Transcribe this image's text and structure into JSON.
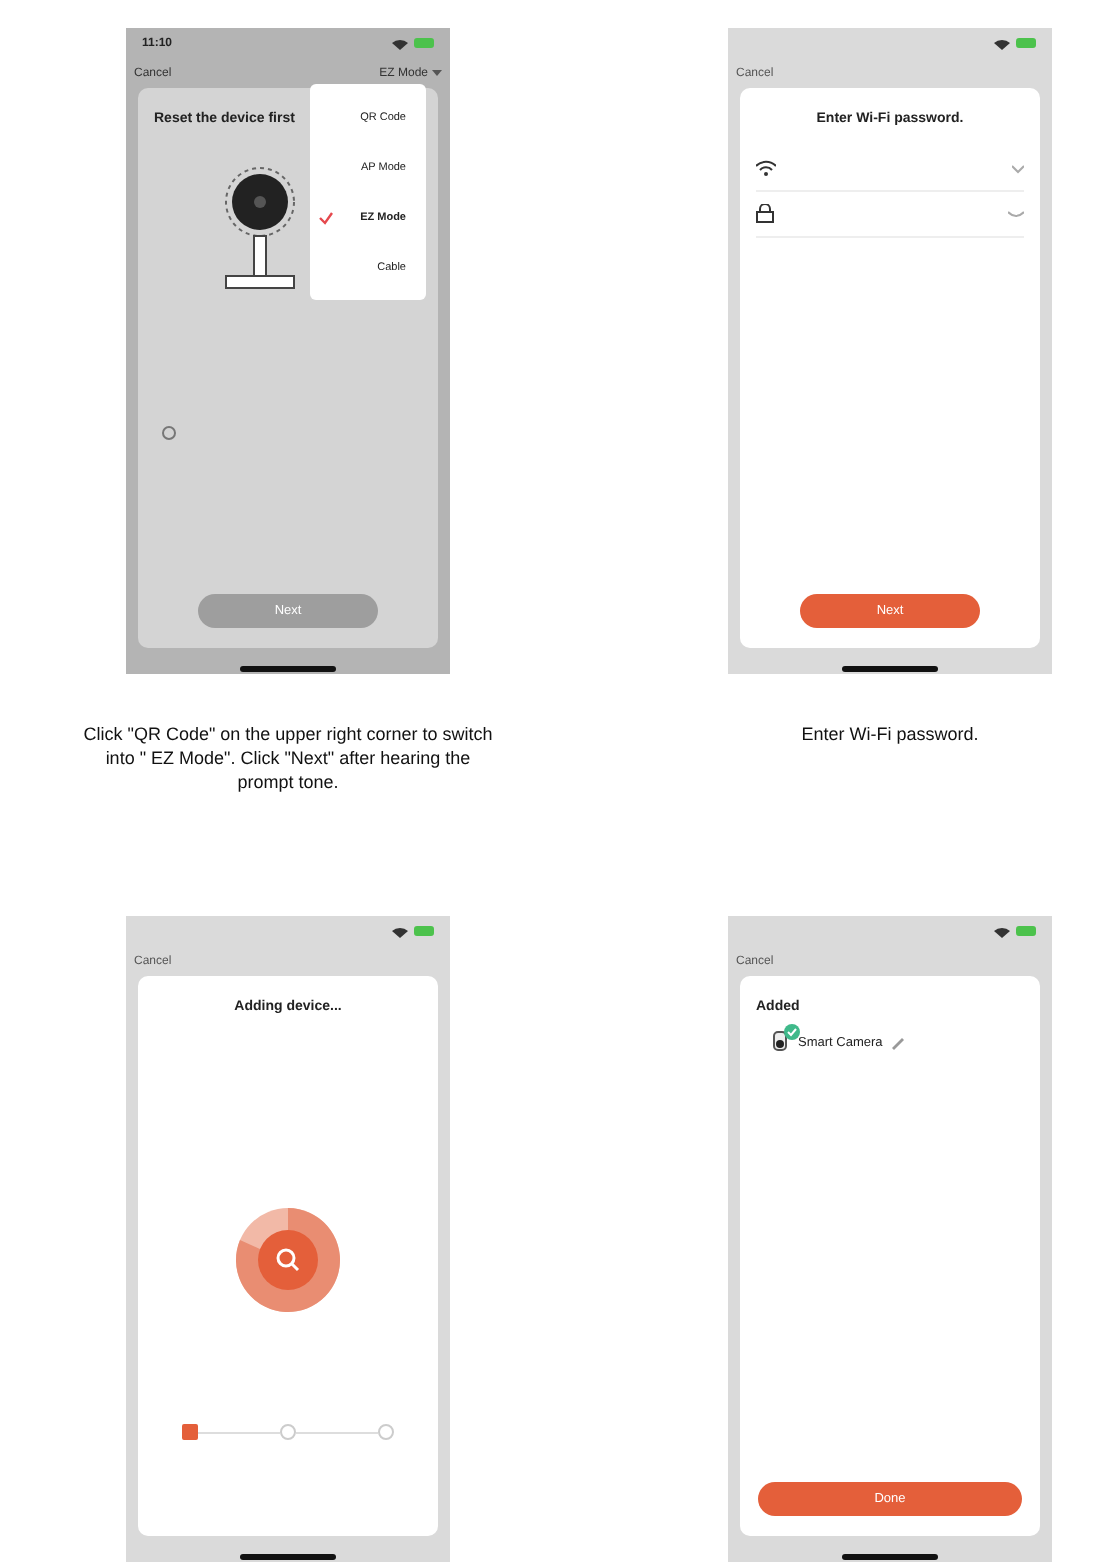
{
  "screens": [
    {
      "kind": "mode_select",
      "time": "11:10",
      "cancel": "Cancel",
      "mode_button": "EZ Mode",
      "title": "Reset the device first",
      "dimmed": true,
      "button": {
        "label": "Next",
        "disabled": true
      },
      "menu": [
        {
          "label": "QR Code",
          "selected": false
        },
        {
          "label": "AP Mode",
          "selected": false
        },
        {
          "label": "EZ Mode",
          "selected": true
        },
        {
          "label": "Cable",
          "selected": false
        }
      ],
      "caption": "Click \"QR Code\" on the upper right corner to switch into \" EZ Mode\". Click \"Next\" after hearing the prompt tone."
    },
    {
      "kind": "wifi",
      "cancel": "Cancel",
      "title": "Enter Wi-Fi password.",
      "button": {
        "label": "Next",
        "disabled": false
      },
      "caption": "Enter Wi-Fi password."
    },
    {
      "kind": "adding",
      "cancel": "Cancel",
      "title": "Adding device...",
      "steps": [
        {
          "active": true
        },
        {
          "active": false
        },
        {
          "active": false
        }
      ]
    },
    {
      "kind": "added",
      "cancel": "Cancel",
      "title": "Added",
      "device_name": "Smart Camera",
      "button": {
        "label": "Done",
        "disabled": false
      }
    }
  ]
}
